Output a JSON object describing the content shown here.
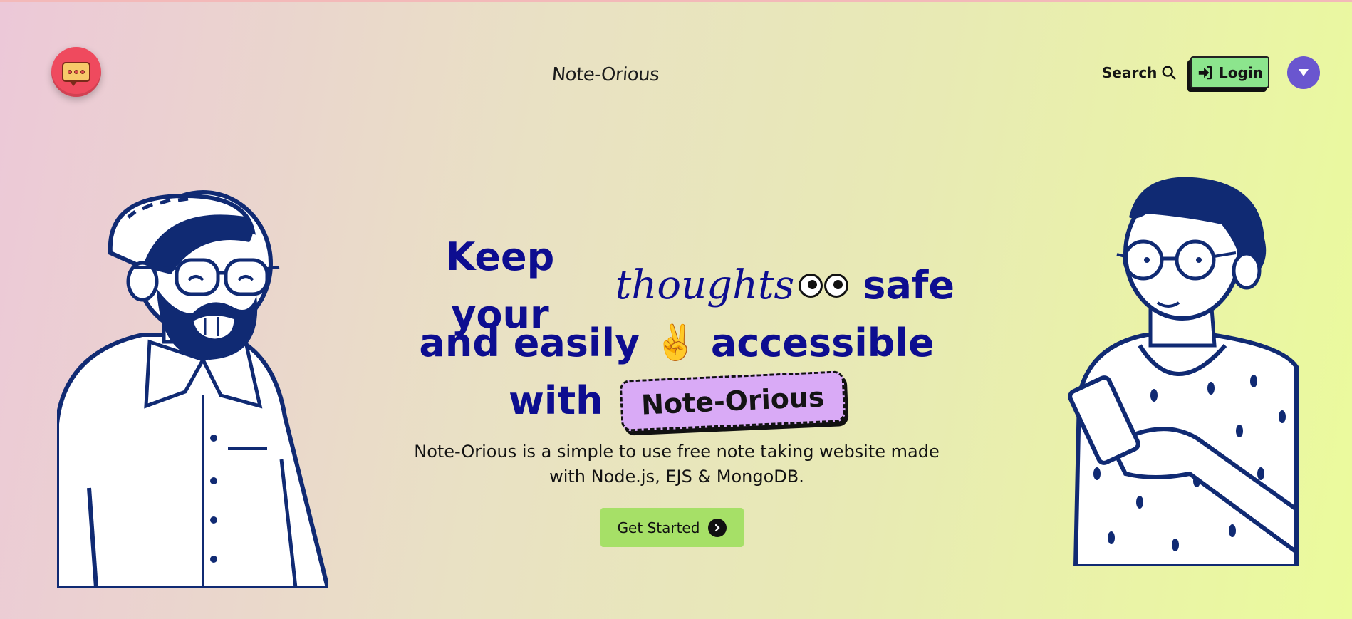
{
  "header": {
    "brand": "Note-Orious",
    "search_label": "Search",
    "login_label": "Login"
  },
  "hero": {
    "line1_a": "Keep your",
    "line1_script": "thoughts",
    "line1_b": "safe",
    "line2_a": "and easily",
    "line2_emoji": "✌️",
    "line2_b": "accessible",
    "line3_a": "with",
    "line3_badge": "Note-Orious",
    "description_line1": "Note-Orious is a simple to use free note taking website made",
    "description_line2": "with Node.js, EJS & MongoDB.",
    "cta_label": "Get Started"
  },
  "icons": {
    "logo": "chat-bubble-icon",
    "search": "search-icon",
    "login": "sign-in-icon",
    "avatar": "caret-down-icon",
    "cta": "chevron-right-icon"
  },
  "colors": {
    "heading": "#0d0d90",
    "illustration": "#102a73",
    "logo_bg": "#ef4a5e",
    "login_bg": "#8ce58d",
    "avatar_bg": "#6a56cf",
    "cta_bg": "#a6e067",
    "badge_bg": "#d9aaf6"
  }
}
